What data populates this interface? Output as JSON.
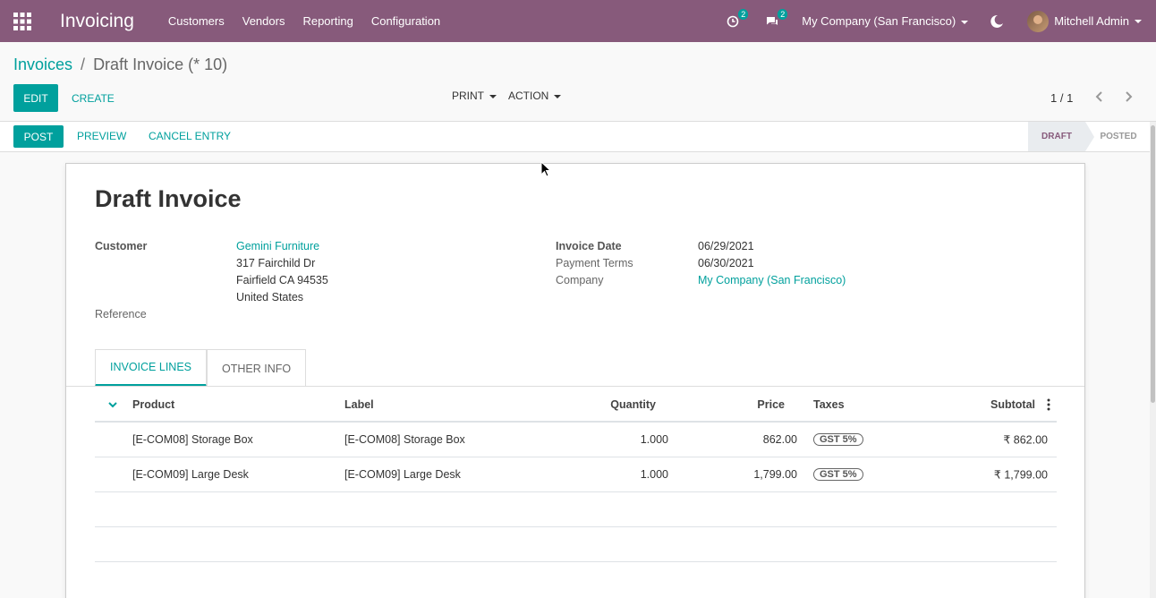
{
  "navbar": {
    "app_name": "Invoicing",
    "menu": [
      "Customers",
      "Vendors",
      "Reporting",
      "Configuration"
    ],
    "activity_badge": "2",
    "messages_badge": "2",
    "company": "My Company (San Francisco)",
    "user": "Mitchell Admin",
    "bg_color": "#875a7b"
  },
  "breadcrumb": {
    "parent": "Invoices",
    "current": "Draft Invoice (* 10)"
  },
  "control": {
    "edit": "EDIT",
    "create": "CREATE",
    "print": "PRINT",
    "action": "ACTION",
    "pager": "1 / 1"
  },
  "statusbar": {
    "post": "POST",
    "preview": "PREVIEW",
    "cancel": "CANCEL ENTRY",
    "stage_draft": "DRAFT",
    "stage_posted": "POSTED"
  },
  "form": {
    "title": "Draft Invoice",
    "customer_label": "Customer",
    "customer_name": "Gemini Furniture",
    "address_line1": "317 Fairchild Dr",
    "address_line2": "Fairfield CA 94535",
    "address_country": "United States",
    "reference_label": "Reference",
    "invoice_date_label": "Invoice Date",
    "invoice_date": "06/29/2021",
    "payment_terms_label": "Payment Terms",
    "payment_terms": "06/30/2021",
    "company_label": "Company",
    "company": "My Company (San Francisco)"
  },
  "tabs": [
    "INVOICE LINES",
    "OTHER INFO"
  ],
  "table": {
    "headers": {
      "product": "Product",
      "label": "Label",
      "quantity": "Quantity",
      "price": "Price",
      "taxes": "Taxes",
      "subtotal": "Subtotal"
    },
    "rows": [
      {
        "product": "[E-COM08] Storage Box",
        "label": "[E-COM08] Storage Box",
        "quantity": "1.000",
        "price": "862.00",
        "tax": "GST 5%",
        "subtotal": "₹ 862.00"
      },
      {
        "product": "[E-COM09] Large Desk",
        "label": "[E-COM09] Large Desk",
        "quantity": "1.000",
        "price": "1,799.00",
        "tax": "GST 5%",
        "subtotal": "₹ 1,799.00"
      }
    ]
  },
  "icons": [
    "apps-icon",
    "activity-icon",
    "chat-icon",
    "moon-icon",
    "chevron-left-icon",
    "chevron-right-icon",
    "chevron-down-icon",
    "kebab-icon",
    "cursor-icon"
  ],
  "colors": {
    "accent": "#00a09d",
    "brand": "#875a7b"
  }
}
